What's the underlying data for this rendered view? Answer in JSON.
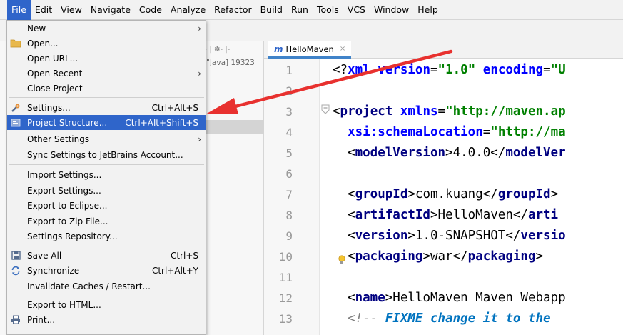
{
  "menubar": {
    "items": [
      "File",
      "Edit",
      "View",
      "Navigate",
      "Code",
      "Analyze",
      "Refactor",
      "Build",
      "Run",
      "Tools",
      "VCS",
      "Window",
      "Help"
    ]
  },
  "file_menu": {
    "new": "New",
    "open": "Open...",
    "open_url": "Open URL...",
    "open_recent": "Open Recent",
    "close_project": "Close Project",
    "settings": "Settings...",
    "settings_sc": "Ctrl+Alt+S",
    "project_structure": "Project Structure...",
    "project_structure_sc": "Ctrl+Alt+Shift+S",
    "other_settings": "Other Settings",
    "sync_settings": "Sync Settings to JetBrains Account...",
    "import_settings": "Import Settings...",
    "export_settings": "Export Settings...",
    "export_eclipse": "Export to Eclipse...",
    "export_zip": "Export to Zip File...",
    "settings_repo": "Settings Repository...",
    "save_all": "Save All",
    "save_all_sc": "Ctrl+S",
    "synchronize": "Synchronize",
    "synchronize_sc": "Ctrl+Alt+Y",
    "invalidate": "Invalidate Caches / Restart...",
    "export_html": "Export to HTML...",
    "print": "Print..."
  },
  "project_panel": {
    "toolbar_text": "÷ | ✲- |-",
    "tree_text": "\"Java] 19323"
  },
  "editor": {
    "tab_icon": "m",
    "tab_label": "HelloMaven",
    "tab_close": "×",
    "lines": [
      {
        "n": "1",
        "parts": [
          [
            "t",
            "<?"
          ],
          [
            "attr",
            "xml"
          ],
          [
            "t",
            " "
          ],
          [
            "attr",
            "version"
          ],
          [
            "t",
            "="
          ],
          [
            "str",
            "\"1.0\""
          ],
          [
            "t",
            " "
          ],
          [
            "attr",
            "encoding"
          ],
          [
            "t",
            "="
          ],
          [
            "str",
            "\"U"
          ]
        ]
      },
      {
        "n": "2",
        "parts": []
      },
      {
        "n": "3",
        "parts": [
          [
            "t",
            "<"
          ],
          [
            "tag",
            "project"
          ],
          [
            "t",
            " "
          ],
          [
            "attr",
            "xmlns"
          ],
          [
            "t",
            "="
          ],
          [
            "str",
            "\"http://maven.ap"
          ]
        ]
      },
      {
        "n": "4",
        "parts": [
          [
            "t",
            "  "
          ],
          [
            "attr",
            "xsi:schemaLocation"
          ],
          [
            "t",
            "="
          ],
          [
            "str",
            "\"http://ma"
          ]
        ]
      },
      {
        "n": "5",
        "parts": [
          [
            "t",
            "  <"
          ],
          [
            "tag",
            "modelVersion"
          ],
          [
            "t",
            ">4.0.0</"
          ],
          [
            "tag",
            "modelVer"
          ]
        ]
      },
      {
        "n": "6",
        "parts": []
      },
      {
        "n": "7",
        "parts": [
          [
            "t",
            "  <"
          ],
          [
            "tag",
            "groupId"
          ],
          [
            "t",
            ">com.kuang</"
          ],
          [
            "tag",
            "groupId"
          ],
          [
            "t",
            ">"
          ]
        ]
      },
      {
        "n": "8",
        "parts": [
          [
            "t",
            "  <"
          ],
          [
            "tag",
            "artifactId"
          ],
          [
            "t",
            ">HelloMaven</"
          ],
          [
            "tag",
            "arti"
          ]
        ]
      },
      {
        "n": "9",
        "parts": [
          [
            "t",
            "  <"
          ],
          [
            "tag",
            "version"
          ],
          [
            "t",
            ">1.0-SNAPSHOT</"
          ],
          [
            "tag",
            "versio"
          ]
        ]
      },
      {
        "n": "10",
        "parts": [
          [
            "t",
            "  <"
          ],
          [
            "tag",
            "packaging"
          ],
          [
            "t",
            ">war</"
          ],
          [
            "tag",
            "packaging"
          ],
          [
            "t",
            ">"
          ]
        ]
      },
      {
        "n": "11",
        "parts": []
      },
      {
        "n": "12",
        "parts": [
          [
            "t",
            "  <"
          ],
          [
            "tag",
            "name"
          ],
          [
            "t",
            ">HelloMaven Maven Webapp"
          ]
        ]
      },
      {
        "n": "13",
        "parts": [
          [
            "cm",
            "  <!-- "
          ],
          [
            "todo",
            "FIXME change it to the "
          ]
        ]
      }
    ],
    "current_line": "11"
  },
  "colors": {
    "selection": "#2f65ca",
    "annotation_arrow": "#e8312f"
  }
}
